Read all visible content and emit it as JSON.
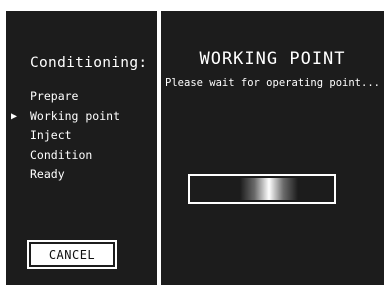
{
  "sidebar": {
    "heading": "Conditioning:",
    "current_marker": "▶",
    "steps": [
      {
        "label": "Prepare",
        "current": false
      },
      {
        "label": "Working point",
        "current": true
      },
      {
        "label": "Inject",
        "current": false
      },
      {
        "label": "Condition",
        "current": false
      },
      {
        "label": "Ready",
        "current": false
      }
    ],
    "cancel_label": "CANCEL"
  },
  "main": {
    "title": "WORKING POINT",
    "message": "Please wait for operating point..."
  },
  "colors": {
    "panel_bg": "#1c1c1c",
    "text": "#ffffff",
    "background": "#ffffff"
  }
}
